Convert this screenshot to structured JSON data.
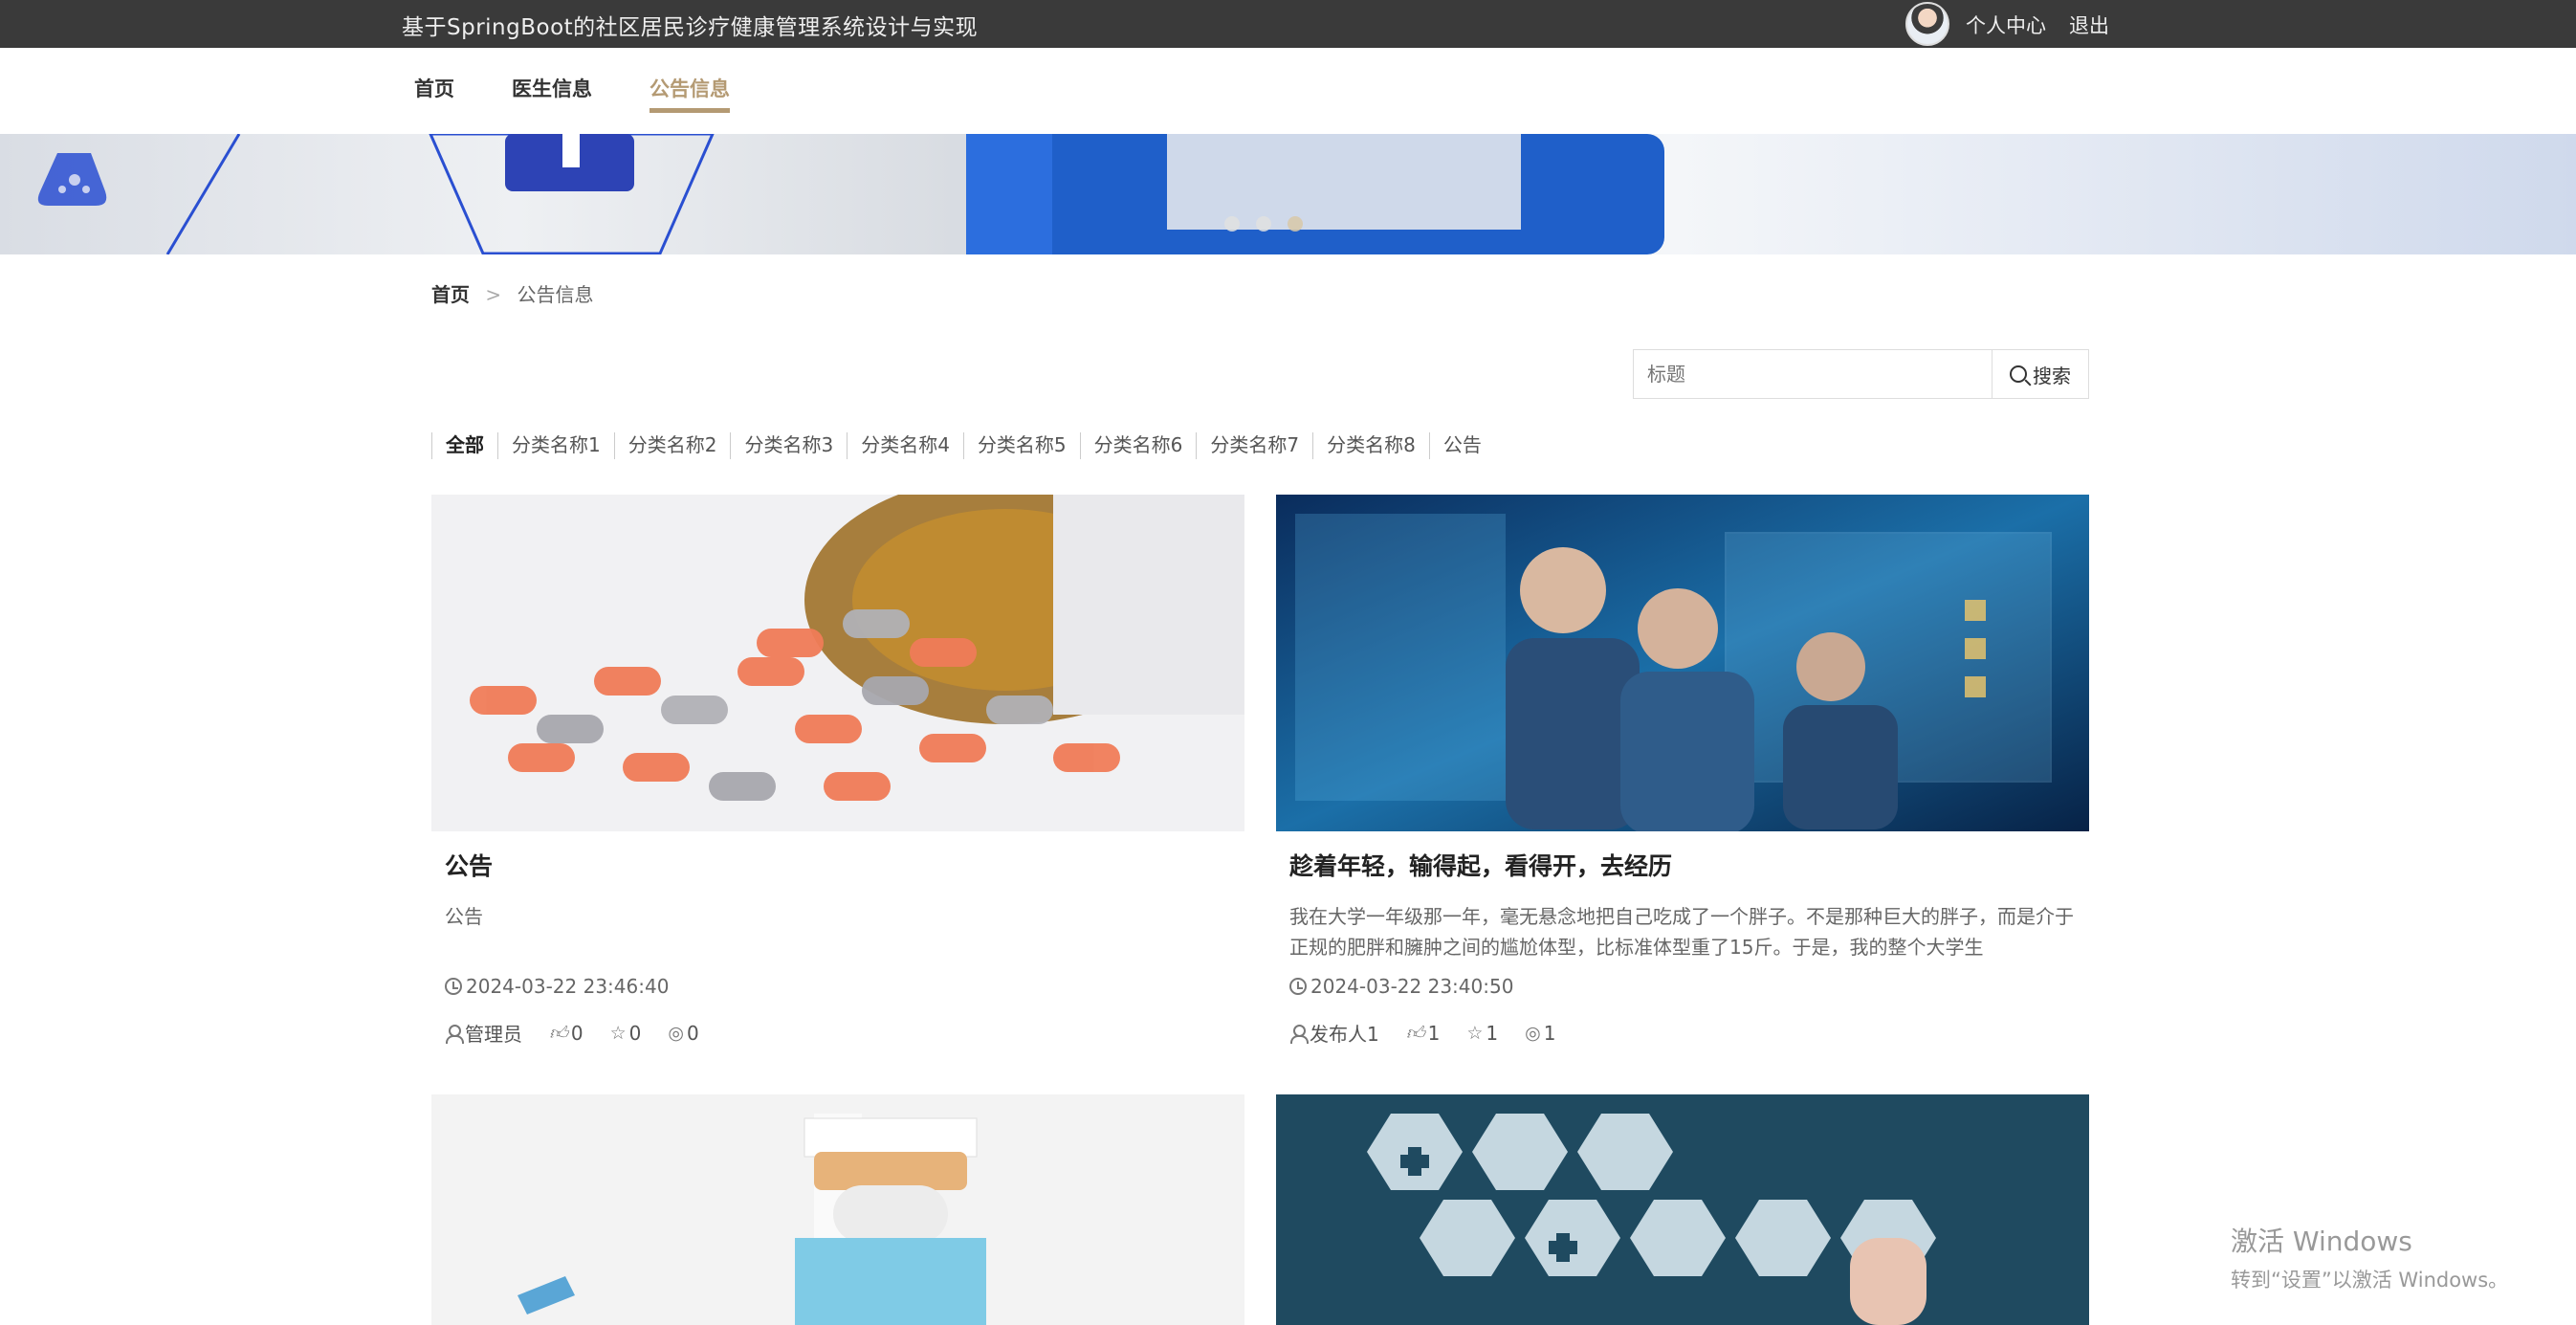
{
  "topbar": {
    "site_title": "基于SpringBoot的社区居民诊疗健康管理系统设计与实现",
    "user_center": "个人中心",
    "logout": "退出"
  },
  "nav": {
    "items": [
      {
        "label": "首页"
      },
      {
        "label": "医生信息"
      },
      {
        "label": "公告信息",
        "active": true
      }
    ]
  },
  "banner": {
    "slides": 3,
    "active_slide": 3
  },
  "breadcrumb": {
    "home": "首页",
    "sep": ">",
    "current": "公告信息"
  },
  "search": {
    "placeholder": "标题",
    "button": "搜索"
  },
  "categories": [
    "全部",
    "分类名称1",
    "分类名称2",
    "分类名称3",
    "分类名称4",
    "分类名称5",
    "分类名称6",
    "分类名称7",
    "分类名称8",
    "公告"
  ],
  "cards": [
    {
      "title": "公告",
      "desc": "公告",
      "time": "2024-03-22 23:46:40",
      "author": "管理员",
      "likes": "0",
      "favorites": "0",
      "views": "0"
    },
    {
      "title": "趁着年轻，输得起，看得开，去经历",
      "desc": "我在大学一年级那一年，毫无悬念地把自己吃成了一个胖子。不是那种巨大的胖子，而是介于正规的肥胖和臃肿之间的尴尬体型，比标准体型重了15斤。于是，我的整个大学生",
      "time": "2024-03-22 23:40:50",
      "author": "发布人1",
      "likes": "1",
      "favorites": "1",
      "views": "1"
    }
  ],
  "watermark": {
    "line1": "激活 Windows",
    "line2": "转到“设置”以激活 Windows。"
  },
  "colors": {
    "accent": "#b49a73",
    "topbar": "#3a3a3a"
  }
}
